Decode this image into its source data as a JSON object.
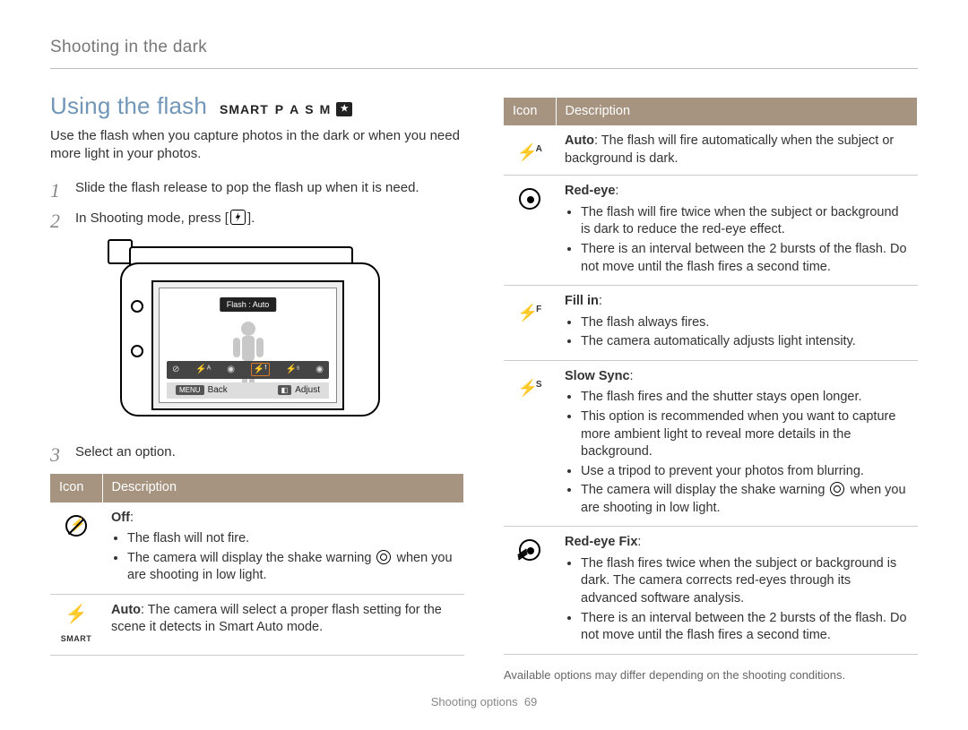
{
  "breadcrumb": "Shooting in the dark",
  "section_title": "Using the flash",
  "mode_row": {
    "smart": "SMART",
    "p": "P",
    "a": "A",
    "s": "S",
    "m": "M",
    "star": "★"
  },
  "intro": "Use the flash when you capture photos in the dark or when you need more light in your photos.",
  "steps": {
    "s1": "Slide the flash release to pop the flash up when it is need.",
    "s2a": "In Shooting mode, press [",
    "s2b": "].",
    "s3": "Select an option."
  },
  "camera": {
    "flash_label": "Flash : Auto",
    "back": "Back",
    "adjust": "Adjust",
    "menu_tag": "MENU"
  },
  "table_head": {
    "icon": "Icon",
    "desc": "Description"
  },
  "left_rows": {
    "off": {
      "title": "Off",
      "b1": "The flash will not fire.",
      "b2a": "The camera will display the shake warning ",
      "b2b": " when you are shooting in low light."
    },
    "auto_smart": {
      "title": "Auto",
      "body": ": The camera will select a proper flash setting for the scene it detects in Smart Auto mode."
    }
  },
  "right_rows": {
    "auto": {
      "title": "Auto",
      "body": ": The flash will fire automatically when the subject or background is dark."
    },
    "redeye": {
      "title": "Red-eye",
      "b1": "The flash will fire twice when the subject or background is dark to reduce the red-eye effect.",
      "b2": "There is an interval between the 2 bursts of the flash. Do not move until the flash fires a second time."
    },
    "fillin": {
      "title": "Fill in",
      "b1": "The flash always fires.",
      "b2": "The camera automatically adjusts light intensity."
    },
    "slow": {
      "title": "Slow Sync",
      "b1": "The flash fires and the shutter stays open longer.",
      "b2": "This option is recommended when you want to capture more ambient light to reveal more details in the background.",
      "b3": "Use a tripod to prevent your photos from blurring.",
      "b4a": "The camera will display the shake warning ",
      "b4b": " when you are shooting in low light."
    },
    "redeyefix": {
      "title": "Red-eye Fix",
      "b1": "The flash fires twice when the subject or background is dark. The camera corrects red-eyes through its advanced software analysis.",
      "b2": "There is an interval between the 2 bursts of the flash. Do not move until the flash fires a second time."
    }
  },
  "footnote": "Available options may differ depending on the shooting conditions.",
  "footer": {
    "section": "Shooting options",
    "page": "69"
  }
}
